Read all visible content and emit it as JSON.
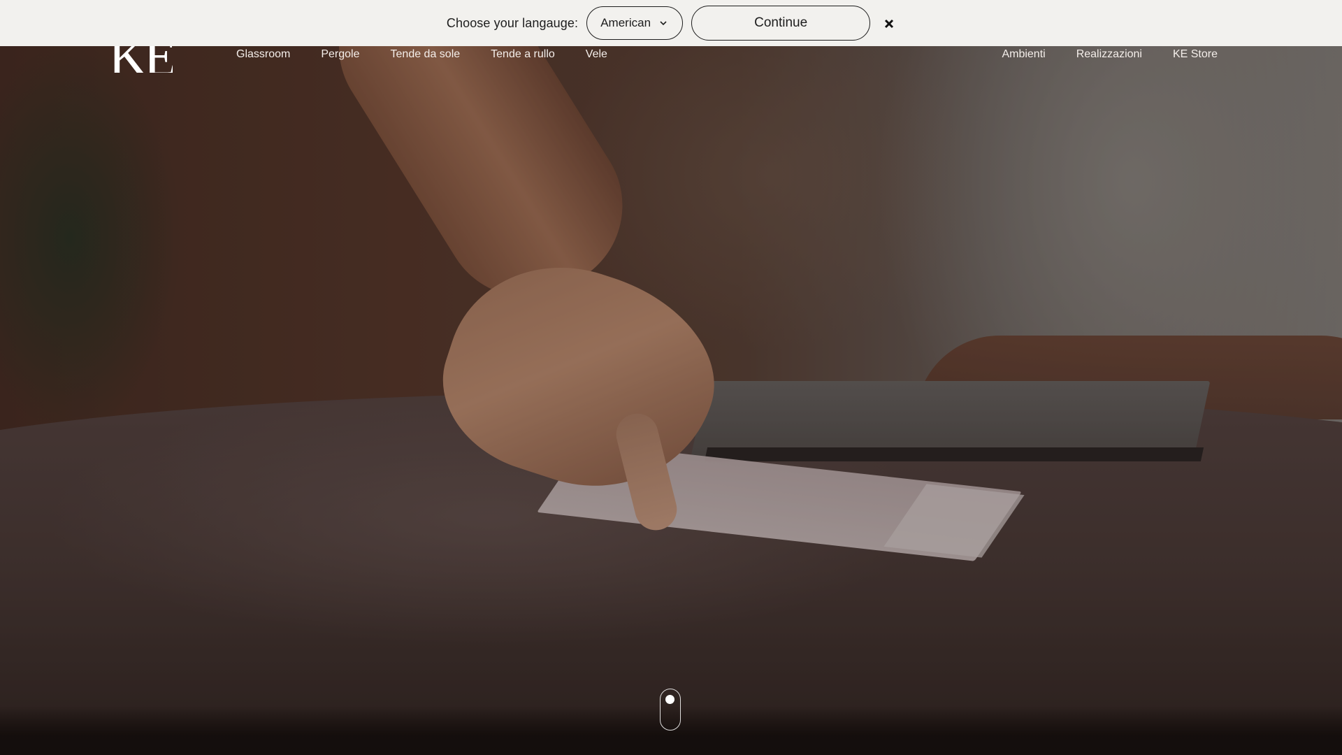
{
  "language_bar": {
    "label": "Choose your langauge:",
    "selected_language": "American",
    "continue_label": "Continue",
    "close_icon": "close-icon",
    "chevron_icon": "chevron-down-icon"
  },
  "header": {
    "logo_text": "KE",
    "nav_left": [
      "Glassroom",
      "Pergole",
      "Tende da sole",
      "Tende a rullo",
      "Vele"
    ],
    "nav_right": [
      "Ambienti",
      "Realizzazioni",
      "KE Store"
    ]
  },
  "hero": {
    "scroll_icon": "mouse-scroll-icon"
  },
  "colors": {
    "banner_bg": "#f2f1ee",
    "banner_text": "#1d1d1d",
    "nav_text": "#f4eeea"
  }
}
